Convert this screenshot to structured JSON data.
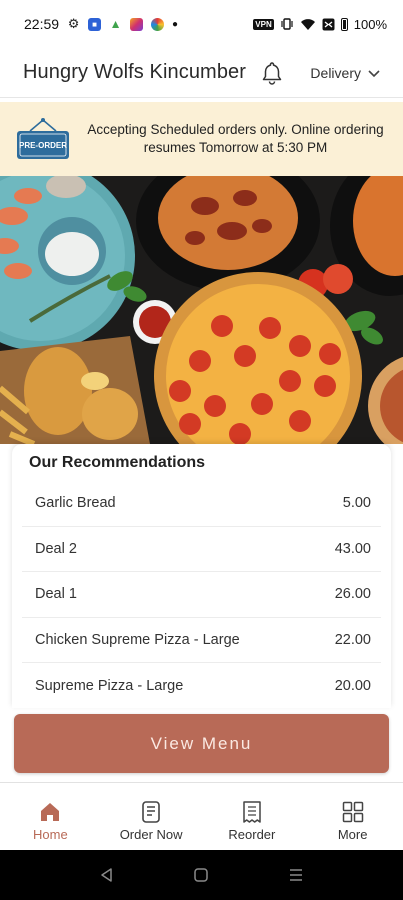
{
  "status_bar": {
    "time": "22:59",
    "vpn": "VPN",
    "battery": "100%",
    "left_icons": [
      "gear-icon",
      "app-blue-icon",
      "android-icon",
      "instagram-icon",
      "color-app-icon",
      "dot-icon"
    ],
    "right_icons": [
      "vpn-icon",
      "vibrate-icon",
      "wifi-icon",
      "nfc-icon",
      "battery-icon"
    ]
  },
  "header": {
    "title": "Hungry Wolfs Kincumber",
    "delivery_label": "Delivery",
    "icons": [
      "bell-icon",
      "chevron-down-icon"
    ]
  },
  "banner": {
    "badge": "PRE-ORDER",
    "message": "Accepting Scheduled orders only. Online ordering resumes Tomorrow at 5:30 PM",
    "background": "#fbf0d6"
  },
  "recommendations": {
    "title": "Our Recommendations",
    "items": [
      {
        "name": "Garlic Bread",
        "price": "5.00"
      },
      {
        "name": "Deal 2",
        "price": "43.00"
      },
      {
        "name": "Deal 1",
        "price": "26.00"
      },
      {
        "name": "Chicken Supreme Pizza - Large",
        "price": "22.00"
      },
      {
        "name": "Supreme Pizza - Large",
        "price": "20.00"
      }
    ]
  },
  "view_menu_label": "View Menu",
  "bottom_nav": [
    {
      "label": "Home",
      "icon": "home-icon",
      "active": true
    },
    {
      "label": "Order Now",
      "icon": "order-icon",
      "active": false
    },
    {
      "label": "Reorder",
      "icon": "receipt-icon",
      "active": false
    },
    {
      "label": "More",
      "icon": "grid-icon",
      "active": false
    }
  ],
  "colors": {
    "accent": "#b86a57",
    "banner": "#fbf0d6",
    "badge": "#2d6c9c"
  }
}
